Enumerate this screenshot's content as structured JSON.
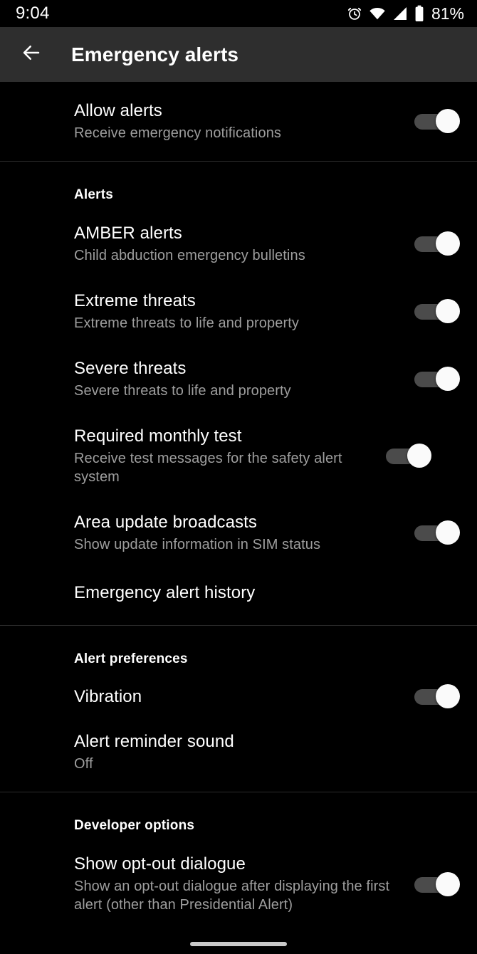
{
  "status_bar": {
    "time": "9:04",
    "battery_percent": "81%",
    "icons": [
      "alarm-icon",
      "wifi-icon",
      "cellular-signal-icon",
      "battery-icon"
    ]
  },
  "app_bar": {
    "back_label": "back-arrow",
    "title": "Emergency alerts"
  },
  "sections": [
    {
      "header": null,
      "rows": [
        {
          "title": "Allow alerts",
          "summary": "Receive emergency notifications",
          "toggle": "on"
        }
      ]
    },
    {
      "header": "Alerts",
      "rows": [
        {
          "title": "AMBER alerts",
          "summary": "Child abduction emergency bulletins",
          "toggle": "on"
        },
        {
          "title": "Extreme threats",
          "summary": "Extreme threats to life and property",
          "toggle": "on"
        },
        {
          "title": "Severe threats",
          "summary": "Severe threats to life and property",
          "toggle": "on"
        },
        {
          "title": "Required monthly test",
          "summary": "Receive test messages for the safety alert system",
          "toggle": "on"
        },
        {
          "title": "Area update broadcasts",
          "summary": "Show update information in SIM status",
          "toggle": "on"
        },
        {
          "title": "Emergency alert history",
          "summary": "",
          "toggle": null
        }
      ]
    },
    {
      "header": "Alert preferences",
      "rows": [
        {
          "title": "Vibration",
          "summary": "",
          "toggle": "on"
        },
        {
          "title": "Alert reminder sound",
          "summary": "Off",
          "toggle": null
        }
      ]
    },
    {
      "header": "Developer options",
      "rows": [
        {
          "title": "Show opt-out dialogue",
          "summary": "Show an opt-out dialogue after displaying the first alert (other than Presidential Alert)",
          "toggle": "on"
        }
      ]
    }
  ],
  "colors": {
    "background": "#000000",
    "app_bar": "#2e2e2e",
    "primary_text": "#ffffff",
    "secondary_text": "#9e9e9e",
    "divider": "#2b2b2b",
    "switch_track_on": "#4b4b4b",
    "switch_thumb_on": "#fafafa",
    "home_indicator": "#c9c9c9"
  }
}
